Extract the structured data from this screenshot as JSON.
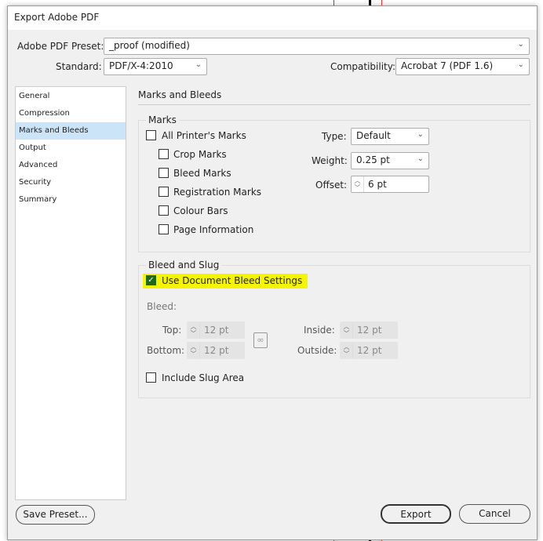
{
  "title": "Export Adobe PDF",
  "preset": {
    "label": "Adobe PDF Preset:",
    "value": "_proof (modified)"
  },
  "standard": {
    "label": "Standard:",
    "value": "PDF/X-4:2010"
  },
  "compatibility": {
    "label": "Compatibility:",
    "value": "Acrobat 7 (PDF 1.6)"
  },
  "sidebar": {
    "items": [
      "General",
      "Compression",
      "Marks and Bleeds",
      "Output",
      "Advanced",
      "Security",
      "Summary"
    ],
    "selected": "Marks and Bleeds"
  },
  "section_title": "Marks and Bleeds",
  "marks": {
    "legend": "Marks",
    "all": "All Printer's Marks",
    "items": [
      "Crop Marks",
      "Bleed Marks",
      "Registration Marks",
      "Colour Bars",
      "Page Information"
    ],
    "type_label": "Type:",
    "type_value": "Default",
    "weight_label": "Weight:",
    "weight_value": "0.25 pt",
    "offset_label": "Offset:",
    "offset_value": "6 pt"
  },
  "bleed": {
    "legend": "Bleed and Slug",
    "use_doc": "Use Document Bleed Settings",
    "use_doc_checked": true,
    "bleed_label": "Bleed:",
    "top_label": "Top:",
    "top": "12 pt",
    "bottom_label": "Bottom:",
    "bottom": "12 pt",
    "inside_label": "Inside:",
    "inside": "12 pt",
    "outside_label": "Outside:",
    "outside": "12 pt",
    "slug": "Include Slug Area"
  },
  "buttons": {
    "save_preset": "Save Preset...",
    "export": "Export",
    "cancel": "Cancel"
  },
  "colors": {
    "highlight": "#f5f500",
    "selected": "#cce4f7",
    "check": "#1a6b1a"
  }
}
